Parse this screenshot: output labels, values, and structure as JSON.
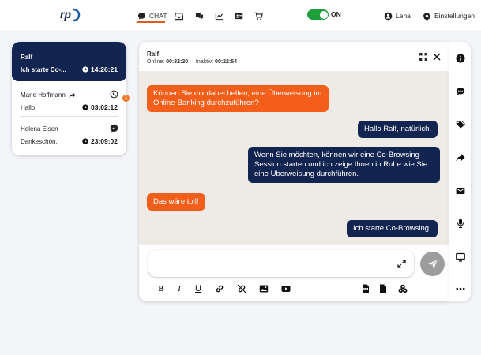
{
  "nav": {
    "chat_label": "CHAT",
    "toggle_label": "ON",
    "user_label": "Lena",
    "settings_label": "Einstellungen"
  },
  "conversations": [
    {
      "name": "Ralf",
      "preview": "Ich starte Co-...",
      "time": "14:26:21",
      "active": true
    },
    {
      "name": "Marie Hoffmann",
      "preview": "Hallo",
      "time": "03:02:12",
      "channel": "whatsapp-icon",
      "badge": "1"
    },
    {
      "name": "Helena Eisen",
      "preview": "Dankeschön.",
      "time": "23:09:02",
      "channel": "messenger-icon"
    }
  ],
  "chat": {
    "name": "Ralf",
    "online_label": "Online:",
    "online_time": "00:32:20",
    "inactive_label": "Inaktiv:",
    "inactive_time": "00:22:54",
    "messages": [
      {
        "dir": "in",
        "text": "Können Sie mir dabei helfen, eine Überweisung im Online-Banking durchzuführen?"
      },
      {
        "dir": "out",
        "text": "Hallo Ralf, natürlich."
      },
      {
        "dir": "out",
        "text": "Wenn Sie möchten, können wir eine Co-Browsing-Session starten und ich zeige Ihnen in Ruhe wie Sie eine Überweisung durchführen."
      },
      {
        "dir": "in",
        "text": "Das wäre toll!"
      },
      {
        "dir": "out",
        "text": "Ich starte Co-Browsing."
      }
    ],
    "input_placeholder": ""
  },
  "colors": {
    "accent_orange": "#f35e1b",
    "navy": "#122550",
    "toggle_green": "#1f9e3a"
  }
}
